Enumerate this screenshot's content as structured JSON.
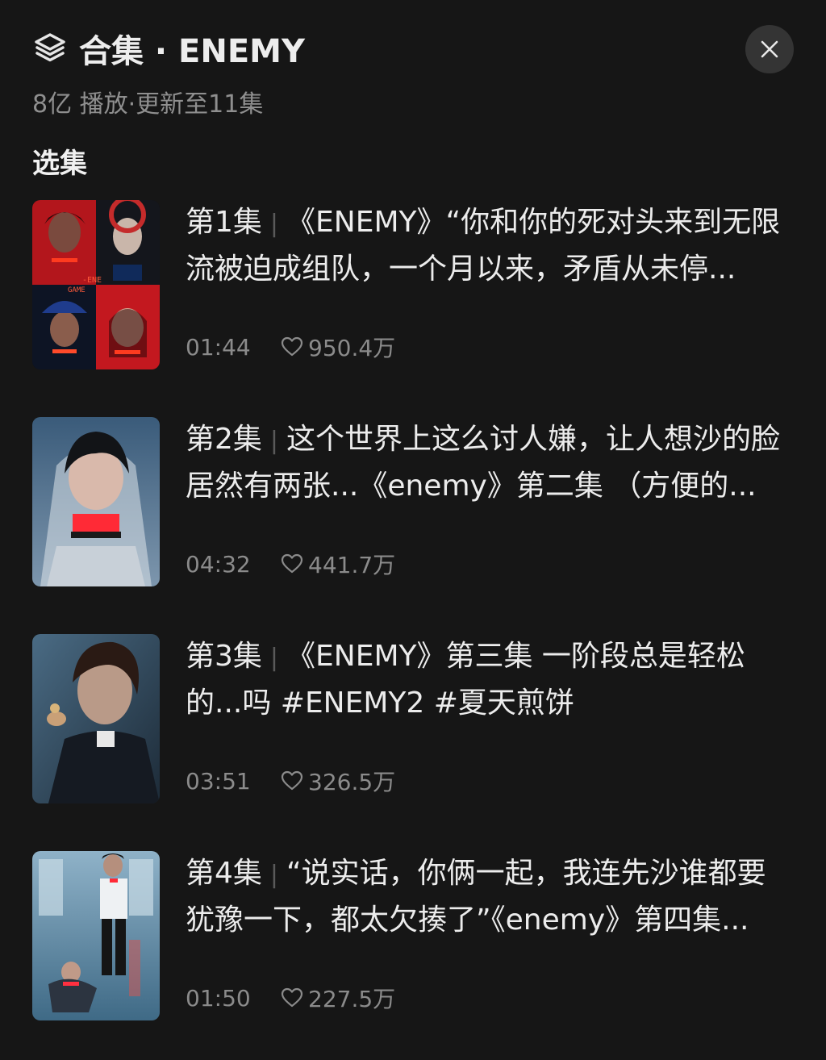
{
  "header": {
    "title": "合集 · ENEMY",
    "icon": "layers-stack-icon",
    "close_icon": "close-icon"
  },
  "subtitle": "8亿 播放·更新至11集",
  "section_title": "选集",
  "episodes": [
    {
      "number": "第1集",
      "title": "《ENEMY》“你和你的死对头来到无限流被迫成组队，一个月以来，矛盾从未停...",
      "duration": "01:44",
      "likes": "950.4万"
    },
    {
      "number": "第2集",
      "title": "这个世界上这么讨人嫌，让人想沙的脸居然有两张...《enemy》第二集 （方便的...",
      "duration": "04:32",
      "likes": "441.7万"
    },
    {
      "number": "第3集",
      "title": "《ENEMY》第三集 一阶段总是轻松的...吗 #ENEMY2 #夏天煎饼",
      "duration": "03:51",
      "likes": "326.5万"
    },
    {
      "number": "第4集",
      "title": "“说实话，你俩一起，我连先沙谁都要犹豫一下，都太欠揍了”《enemy》第四集...",
      "duration": "01:50",
      "likes": "227.5万"
    }
  ],
  "colors": {
    "background": "#161616",
    "text_primary": "#ececec",
    "text_secondary": "#8b8b8b",
    "close_button_bg": "#343434"
  }
}
